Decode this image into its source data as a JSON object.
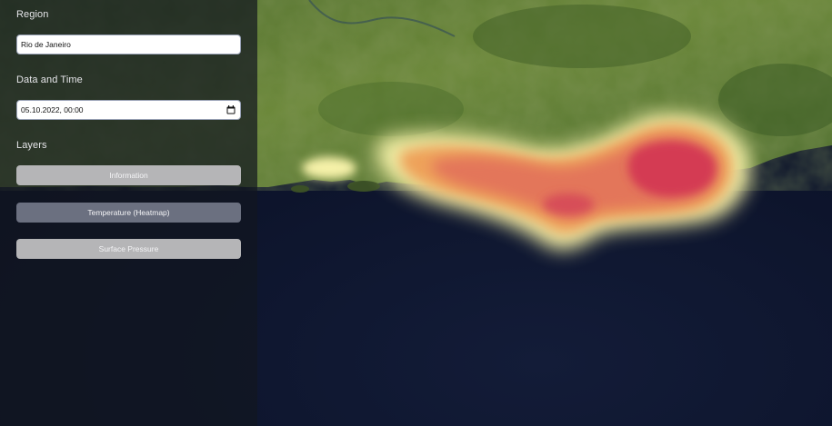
{
  "sidebar": {
    "region_label": "Region",
    "region_value": "Rio de Janeiro",
    "datetime_label": "Data and Time",
    "datetime_value": "05.10.2022, 00:00",
    "layers_label": "Layers",
    "layers": [
      {
        "label": "Information",
        "active": false
      },
      {
        "label": "Temperature (Heatmap)",
        "active": true
      },
      {
        "label": "Surface Pressure",
        "active": false
      }
    ]
  },
  "map": {
    "active_layer": "Temperature (Heatmap)",
    "land_color": "#5f7d34",
    "ocean_color": "#0d1530",
    "heat_colors": [
      "#f5f1a8",
      "#eea25a",
      "#e3765a",
      "#d43a52"
    ]
  }
}
